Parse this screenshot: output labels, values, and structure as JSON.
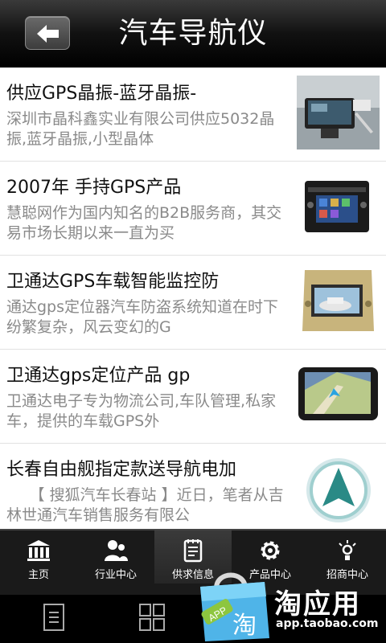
{
  "header": {
    "title": "汽车导航仪"
  },
  "items": [
    {
      "title": "供应GPS晶振-蓝牙晶振-",
      "desc": "深圳市晶科鑫实业有限公司供应5032晶振,蓝牙晶振,小型晶体"
    },
    {
      "title": "2007年 手持GPS产品",
      "desc": "慧聪网作为国内知名的B2B服务商，其交易市场长期以来一直为买"
    },
    {
      "title": "卫通达GPS车载智能监控防",
      "desc": "通达gps定位器汽车防盗系统知道在时下纷繁复杂，风云变幻的G"
    },
    {
      "title": "卫通达gps定位产品 gp",
      "desc": "卫通达电子专为物流公司,车队管理,私家车，提供的车载GPS外"
    },
    {
      "title": "长春自由舰指定款送导航电加",
      "desc": "　　【 搜狐汽车长春站 】近日，笔者从吉林世通汽车销售服务有限公"
    }
  ],
  "tabs": [
    {
      "label": "主页"
    },
    {
      "label": "行业中心"
    },
    {
      "label": "供求信息"
    },
    {
      "label": "产品中心"
    },
    {
      "label": "招商中心"
    }
  ],
  "promo": {
    "name": "淘应用",
    "url": "app.taobao.com",
    "badge": "APP",
    "bag_char": "淘"
  }
}
